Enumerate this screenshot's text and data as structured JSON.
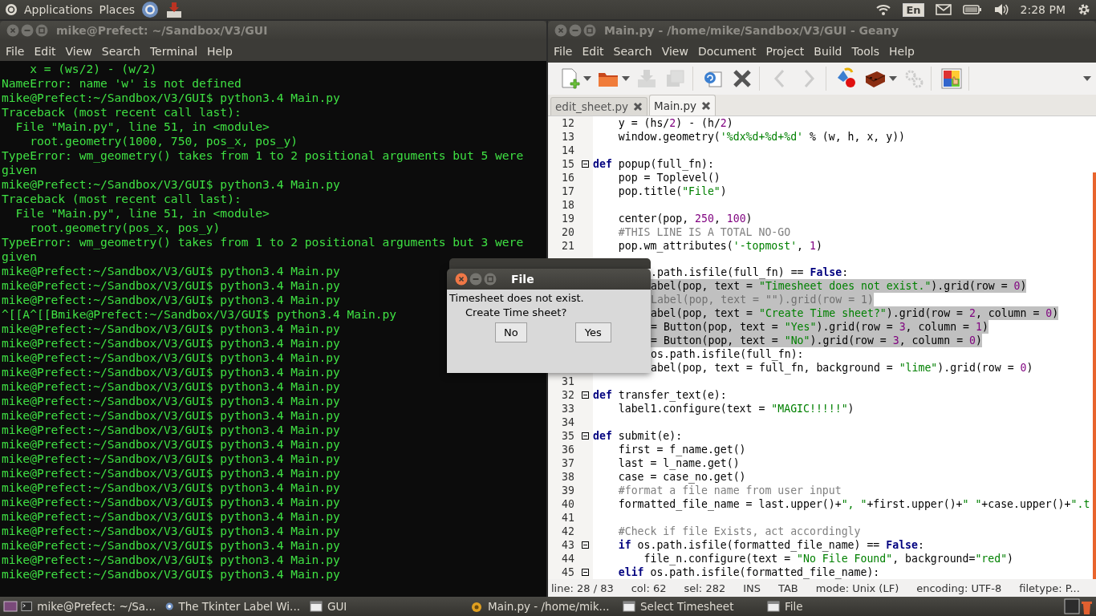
{
  "top_panel": {
    "menus": [
      "Applications",
      "Places"
    ],
    "keyboard_layout": "En",
    "clock": "2:28 PM"
  },
  "terminal": {
    "title": "mike@Prefect: ~/Sandbox/V3/GUI",
    "menu": [
      "File",
      "Edit",
      "View",
      "Search",
      "Terminal",
      "Help"
    ],
    "lines": [
      "    x = (ws/2) - (w/2)",
      "NameError: name 'w' is not defined",
      "mike@Prefect:~/Sandbox/V3/GUI$ python3.4 Main.py",
      "Traceback (most recent call last):",
      "  File \"Main.py\", line 51, in <module>",
      "    root.geometry(1000, 750, pos_x, pos_y)",
      "TypeError: wm_geometry() takes from 1 to 2 positional arguments but 5 were",
      "given",
      "mike@Prefect:~/Sandbox/V3/GUI$ python3.4 Main.py",
      "Traceback (most recent call last):",
      "  File \"Main.py\", line 51, in <module>",
      "    root.geometry(pos_x, pos_y)",
      "TypeError: wm_geometry() takes from 1 to 2 positional arguments but 3 were",
      "given",
      "mike@Prefect:~/Sandbox/V3/GUI$ python3.4 Main.py",
      "mike@Prefect:~/Sandbox/V3/GUI$ python3.4 Main.py",
      "mike@Prefect:~/Sandbox/V3/GUI$ python3.4 Main.py",
      "^[[A^[[Bmike@Prefect:~/Sandbox/V3/GUI$ python3.4 Main.py",
      "mike@Prefect:~/Sandbox/V3/GUI$ python3.4 Main.py",
      "mike@Prefect:~/Sandbox/V3/GUI$ python3.4 Main.py",
      "mike@Prefect:~/Sandbox/V3/GUI$ python3.4 Main.py",
      "mike@Prefect:~/Sandbox/V3/GUI$ python3.4 Main.py",
      "mike@Prefect:~/Sandbox/V3/GUI$ python3.4 Main.py",
      "mike@Prefect:~/Sandbox/V3/GUI$ python3.4 Main.py",
      "mike@Prefect:~/Sandbox/V3/GUI$ python3.4 Main.py",
      "mike@Prefect:~/Sandbox/V3/GUI$ python3.4 Main.py",
      "mike@Prefect:~/Sandbox/V3/GUI$ python3.4 Main.py",
      "mike@Prefect:~/Sandbox/V3/GUI$ python3.4 Main.py",
      "mike@Prefect:~/Sandbox/V3/GUI$ python3.4 Main.py",
      "mike@Prefect:~/Sandbox/V3/GUI$ python3.4 Main.py",
      "mike@Prefect:~/Sandbox/V3/GUI$ python3.4 Main.py",
      "mike@Prefect:~/Sandbox/V3/GUI$ python3.4 Main.py",
      "mike@Prefect:~/Sandbox/V3/GUI$ python3.4 Main.py",
      "mike@Prefect:~/Sandbox/V3/GUI$ python3.4 Main.py",
      "mike@Prefect:~/Sandbox/V3/GUI$ python3.4 Main.py",
      "mike@Prefect:~/Sandbox/V3/GUI$ python3.4 Main.py"
    ]
  },
  "editor": {
    "title": "Main.py - /home/mike/Sandbox/V3/GUI - Geany",
    "menu": [
      "File",
      "Edit",
      "Search",
      "View",
      "Document",
      "Project",
      "Build",
      "Tools",
      "Help"
    ],
    "toolbar": [
      [
        {
          "kind": "new",
          "disabled": false,
          "dropdown": true
        },
        {
          "kind": "open",
          "disabled": false,
          "dropdown": true
        },
        {
          "kind": "save",
          "disabled": true,
          "dropdown": false
        },
        {
          "kind": "save-all",
          "disabled": true,
          "dropdown": false
        }
      ],
      [
        {
          "kind": "reload",
          "disabled": false,
          "dropdown": false
        },
        {
          "kind": "close",
          "disabled": false,
          "dropdown": false
        }
      ],
      [
        {
          "kind": "back",
          "disabled": true,
          "dropdown": false
        },
        {
          "kind": "forward",
          "disabled": true,
          "dropdown": false
        }
      ],
      [
        {
          "kind": "compile",
          "disabled": false,
          "dropdown": false
        },
        {
          "kind": "build",
          "disabled": false,
          "dropdown": true
        },
        {
          "kind": "execute",
          "disabled": true,
          "dropdown": false
        }
      ],
      [
        {
          "kind": "color",
          "disabled": false,
          "dropdown": false
        }
      ]
    ],
    "tabs": [
      {
        "label": "edit_sheet.py",
        "selected": false
      },
      {
        "label": "Main.py",
        "selected": true
      }
    ],
    "lines": [
      {
        "number": "12",
        "text": "\ty = (hs/2) - (h/2)"
      },
      {
        "number": "13",
        "text": "\twindow.geometry('%dx%d+%d+%d' % (w, h, x, y))"
      },
      {
        "number": "14"
      },
      {
        "number": "15",
        "text": "def popup(full_fn):",
        "foldable": true
      },
      {
        "number": "16",
        "text": "\tpop = Toplevel()"
      },
      {
        "number": "17",
        "text": "\tpop.title(\"File\")"
      },
      {
        "number": "18"
      },
      {
        "number": "19",
        "text": "\tcenter(pop, 250, 100)"
      },
      {
        "number": "20",
        "text": "\t#THIS LINE IS A TOTAL NO-GO"
      },
      {
        "number": "21",
        "text": "\tpop.wm_attributes('-topmost', 1)"
      },
      {
        "text": ".path.isfile(full_fn) == False:"
      },
      {
        "selected": true,
        "text": "abel(pop, text = \"Timesheet does not exist.\").grid(row = 0)"
      },
      {
        "selected": true,
        "commented": true,
        "text": "Label(pop, text = \"\").grid(row = 1)"
      },
      {
        "selected": true,
        "text": "abel(pop, text = \"Create Time sheet?\").grid(row = 2, column = 0)"
      },
      {
        "selected": true,
        "text": "= Button(pop, text = \"Yes\").grid(row = 3, column = 1)"
      },
      {
        "selected": true,
        "text": "= Button(pop, text = \"No\").grid(row = 3, column = 0)"
      },
      {
        "text": "os.path.isfile(full_fn):"
      },
      {
        "text": "abel(pop, text = full_fn, background = \"lime\").grid(row = 0)"
      },
      {
        "number": "31"
      },
      {
        "number": "32",
        "text": "def transfer_text(e):",
        "foldable": true
      },
      {
        "number": "33",
        "text": "\tlabel1.configure(text = \"MAGIC!!!!!\")"
      },
      {
        "number": "34"
      },
      {
        "number": "35",
        "text": "def submit(e):",
        "foldable": true
      },
      {
        "number": "36",
        "text": "\tfirst = f_name.get()"
      },
      {
        "number": "37",
        "text": "\tlast = l_name.get()"
      },
      {
        "number": "38",
        "text": "\tcase = case_no.get()"
      },
      {
        "number": "39",
        "text": "\t#format a file name from user input"
      },
      {
        "number": "40",
        "text": "\tformatted_file_name = last.upper()+\", \"+first.upper()+\" \"+case.upper()+\".t"
      },
      {
        "number": "41"
      },
      {
        "number": "42",
        "text": "\t#Check if file Exists, act accordingly"
      },
      {
        "number": "43",
        "text": "\tif os.path.isfile(formatted_file_name) == False:",
        "foldable": true
      },
      {
        "number": "44",
        "text": "\t\tfile_n.configure(text = \"No File Found\", background=\"red\")"
      },
      {
        "number": "45",
        "text": "\telif os.path.isfile(formatted_file_name):",
        "foldable": true
      }
    ],
    "status_bar": [
      "line: 28 / 83",
      "col: 62",
      "sel: 282",
      "INS",
      "TAB",
      "mode: Unix (LF)",
      "encoding: UTF-8",
      "filetype: P..."
    ]
  },
  "dialog": {
    "title": "File",
    "message": "Timesheet does not exist.",
    "question": "Create Time sheet?",
    "buttons": [
      "No",
      "Yes"
    ]
  },
  "taskbar": {
    "items": [
      {
        "label": "mike@Prefect: ~/Sa...",
        "kind": "terminal"
      },
      {
        "label": "The Tkinter Label Wi...",
        "kind": "browser"
      },
      {
        "label": "GUI",
        "kind": "window"
      },
      {
        "label": "Main.py - /home/mik...",
        "kind": "editor"
      },
      {
        "label": "Select Timesheet",
        "kind": "window"
      },
      {
        "label": "File",
        "kind": "window"
      }
    ]
  }
}
